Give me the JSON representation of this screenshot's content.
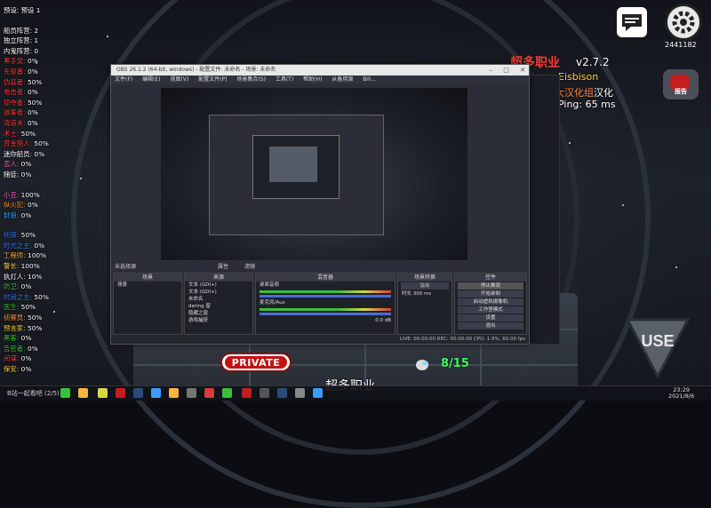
{
  "roles": {
    "preset": "预设: 预设 1",
    "crew_count": "船员阵营: 2",
    "neutral_count": "独立阵营: 1",
    "traitor_count": "内鬼阵营: 0",
    "items": [
      {
        "name": "黑手党:",
        "value": "0%",
        "color": "#ff3b3b"
      },
      {
        "name": "先驱者:",
        "value": "0%",
        "color": "#ff3b3b"
      },
      {
        "name": "伪装者:",
        "value": "50%",
        "color": "#ff3b3b"
      },
      {
        "name": "电击者:",
        "value": "0%",
        "color": "#ff3b3b"
      },
      {
        "name": "掠夺者:",
        "value": "50%",
        "color": "#ff3b3b"
      },
      {
        "name": "骇客者:",
        "value": "0%",
        "color": "#ff3b3b"
      },
      {
        "name": "清道夫:",
        "value": "0%",
        "color": "#ff3b3b"
      },
      {
        "name": "术士:",
        "value": "50%",
        "color": "#ff3b3b"
      },
      {
        "name": "赏金猎人:",
        "value": "50%",
        "color": "#ff3b3b"
      },
      {
        "name": "迷你船员:",
        "value": "0%",
        "color": "#ffffff"
      },
      {
        "name": "恋人:",
        "value": "0%",
        "color": "#ff69b4"
      },
      {
        "name": "赌徒:",
        "value": "0%",
        "color": "#ffffff"
      },
      {
        "name": "小丑:",
        "value": "100%",
        "color": "#ff6bd6"
      },
      {
        "name": "纵火犯:",
        "value": "0%",
        "color": "#ff8c1a"
      },
      {
        "name": "豺狼:",
        "value": "0%",
        "color": "#3c9cff"
      },
      {
        "name": "侦探:",
        "value": "50%",
        "color": "#3c7cff"
      },
      {
        "name": "时光之主:",
        "value": "0%",
        "color": "#3c7cff"
      },
      {
        "name": "工程师:",
        "value": "100%",
        "color": "#ffb23c"
      },
      {
        "name": "警长:",
        "value": "100%",
        "color": "#ffd23c"
      },
      {
        "name": "执灯人:",
        "value": "10%",
        "color": "#ffffff"
      },
      {
        "name": "防卫:",
        "value": "0%",
        "color": "#3cbf3c"
      },
      {
        "name": "时间之主:",
        "value": "50%",
        "color": "#3c7cff"
      },
      {
        "name": "医生:",
        "value": "50%",
        "color": "#3cbf3c"
      },
      {
        "name": "侦察员:",
        "value": "50%",
        "color": "#ff9c3c"
      },
      {
        "name": "预言家:",
        "value": "50%",
        "color": "#ffd23c"
      },
      {
        "name": "黑客:",
        "value": "0%",
        "color": "#3cbf3c"
      },
      {
        "name": "告密者:",
        "value": "0%",
        "color": "#3cbf3c"
      },
      {
        "name": "间谍:",
        "value": "0%",
        "color": "#ff3b3b"
      },
      {
        "name": "保安:",
        "value": "0%",
        "color": "#ffd23c"
      }
    ]
  },
  "mod": {
    "title": "超多职业",
    "version": "v2.7.2",
    "author_label": "Eisbison",
    "loc_prefix": "大汉化组",
    "loc_suffix": "汉化",
    "ping": "Ping: 65 ms"
  },
  "hud": {
    "stream_number": "2441182",
    "report_label": "报告",
    "private_label": "PRIVATE",
    "player_count": "8/15",
    "bottom_title": "超多职业",
    "chat_icon": "chat-bubble-icon",
    "settings_icon": "gear-icon"
  },
  "obs": {
    "title": "OBS 26.1.2 (64-bit, windows) - 配置文件: 未命名 - 场景: 未命名",
    "menu": [
      "文件(F)",
      "编辑(E)",
      "视图(V)",
      "配置文件(P)",
      "场景集合(S)",
      "工具(T)",
      "帮助(H)",
      "从备用源",
      "Bili..."
    ],
    "scene_selector": "未选择源",
    "props_btn": "属性",
    "filters_btn": "滤镜",
    "docks": {
      "scenes": {
        "title": "场景",
        "items": [
          "场景"
        ]
      },
      "sources": {
        "title": "来源",
        "items": [
          "文本 (GDI+)",
          "文本 (GDI+)",
          "未命名",
          "dering 窗",
          "隐藏之窗",
          "游戏捕获"
        ]
      },
      "mixer": {
        "title": "混音器",
        "channels": [
          {
            "name": "桌面音频"
          },
          {
            "name": "麦克风/Aux"
          }
        ],
        "db": "0.0 dB"
      },
      "transitions": {
        "title": "场景转换",
        "type": "淡出",
        "duration_label": "时长",
        "duration": "300 ms"
      },
      "controls": {
        "title": "控件",
        "buttons": [
          "停止推流",
          "开始录制",
          "启动虚拟摄像机",
          "工作室模式",
          "设置",
          "退出"
        ]
      }
    },
    "status": "LIVE: 00:00:00   REC: 00:00:00   CPU: 1.9%, 60.00 fps"
  },
  "taskbar": {
    "start_text": "B站一起看吧",
    "page": "(2/5)",
    "time": "23:29",
    "date": "2021/8/6"
  }
}
